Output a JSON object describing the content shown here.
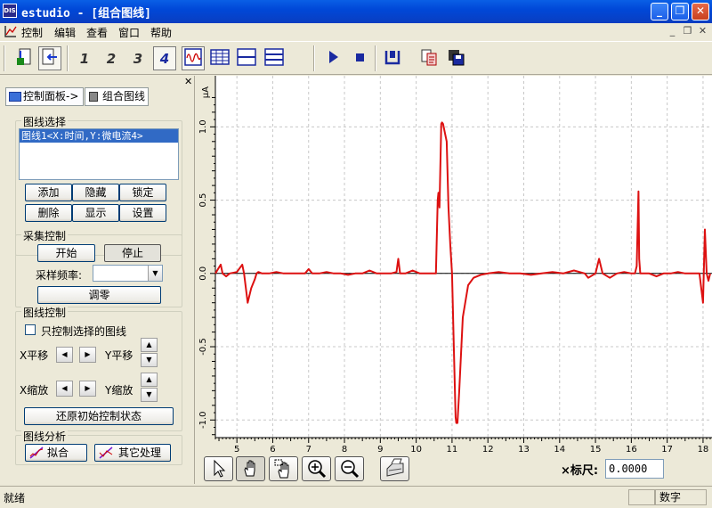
{
  "window": {
    "title": "estudio - [组合图线]",
    "app_icon_text": "DIS"
  },
  "menu": {
    "items": [
      "控制",
      "编辑",
      "查看",
      "窗口",
      "帮助"
    ]
  },
  "toolbar": {
    "number_buttons": [
      "1",
      "2",
      "3",
      "4"
    ]
  },
  "left_panel": {
    "tabs": [
      "控制面板->",
      "组合图线"
    ],
    "curve_select": {
      "title": "图线选择",
      "list_items": [
        "图线1<X:时间,Y:微电流4>"
      ],
      "buttons": [
        "添加",
        "隐藏",
        "锁定",
        "删除",
        "显示",
        "设置"
      ]
    },
    "acquisition": {
      "title": "采集控制",
      "start_label": "开始",
      "stop_label": "停止",
      "rate_label": "采样频率:",
      "rate_value": "",
      "zero_label": "调零"
    },
    "curve_control": {
      "title": "图线控制",
      "checkbox_label": "只控制选择的图线",
      "checkbox_checked": false,
      "x_move_label": "X平移",
      "y_move_label": "Y平移",
      "x_zoom_label": "X缩放",
      "y_zoom_label": "Y缩放",
      "reset_label": "还原初始控制状态"
    },
    "analysis": {
      "title": "图线分析",
      "fit_label": "拟合",
      "other_label": "其它处理"
    }
  },
  "bottom_bar": {
    "scale_label": "×标尺:",
    "scale_value": "0.0000"
  },
  "status_bar": {
    "text": "就绪",
    "mode": "数字"
  },
  "colors": {
    "series": "#dd1111",
    "grid": "#c8c8c8",
    "selection": "#316ac5",
    "title_bar": "#0a3dc0"
  },
  "chart_data": {
    "type": "line",
    "ylabel": "μA",
    "xlim": [
      4.4,
      18.2
    ],
    "ylim": [
      -1.12,
      1.3
    ],
    "x_ticks": [
      5,
      6,
      7,
      8,
      9,
      10,
      11,
      12,
      13,
      14,
      15,
      16,
      17,
      18
    ],
    "x_tick_labels": [
      "5",
      "6",
      "7",
      "8",
      "9",
      "10",
      "11",
      "12",
      "13",
      "14",
      "15",
      "16",
      "17",
      "18"
    ],
    "y_ticks": [
      -1.0,
      -0.5,
      0.0,
      0.5,
      1.0
    ],
    "y_tick_labels": [
      "-1.0",
      "-0.5",
      "0.0",
      "0.5",
      "1.0"
    ],
    "grid": true,
    "series": [
      {
        "color": "#dd1111",
        "x": [
          4.4,
          4.55,
          4.6,
          4.7,
          4.8,
          5.0,
          5.15,
          5.2,
          5.3,
          5.4,
          5.5,
          5.55,
          5.6,
          5.7,
          5.9,
          6.1,
          6.3,
          6.5,
          6.7,
          6.9,
          7.0,
          7.1,
          7.3,
          7.5,
          7.7,
          7.9,
          8.1,
          8.3,
          8.5,
          8.7,
          8.9,
          9.1,
          9.3,
          9.45,
          9.5,
          9.55,
          9.7,
          9.9,
          10.1,
          10.3,
          10.5,
          10.55,
          10.6,
          10.62,
          10.65,
          10.7,
          10.72,
          10.75,
          10.85,
          10.9,
          10.95,
          11.0,
          11.05,
          11.1,
          11.12,
          11.15,
          11.2,
          11.3,
          11.45,
          11.6,
          11.8,
          12.0,
          12.3,
          12.6,
          12.9,
          13.2,
          13.5,
          13.8,
          14.1,
          14.4,
          14.7,
          14.8,
          15.0,
          15.05,
          15.1,
          15.2,
          15.4,
          15.6,
          15.8,
          16.0,
          16.1,
          16.15,
          16.2,
          16.22,
          16.25,
          16.3,
          16.5,
          16.7,
          16.9,
          17.1,
          17.3,
          17.5,
          17.7,
          17.9,
          18.0,
          18.05,
          18.1,
          18.15,
          18.2
        ],
        "y": [
          0.0,
          0.06,
          0.0,
          -0.02,
          0.0,
          0.01,
          0.06,
          0.0,
          -0.2,
          -0.1,
          -0.04,
          0.0,
          0.01,
          0.0,
          0.0,
          0.01,
          0.0,
          0.0,
          0.0,
          0.0,
          0.03,
          0.0,
          0.0,
          0.01,
          0.0,
          0.0,
          -0.01,
          0.0,
          0.0,
          0.02,
          0.0,
          0.0,
          0.0,
          0.01,
          0.1,
          0.0,
          0.0,
          0.02,
          0.0,
          0.0,
          0.0,
          0.0,
          0.5,
          0.55,
          0.45,
          1.02,
          1.03,
          1.02,
          0.9,
          0.45,
          0.2,
          0.0,
          -0.5,
          -0.98,
          -1.02,
          -1.02,
          -0.8,
          -0.3,
          -0.08,
          -0.03,
          -0.01,
          0.0,
          0.01,
          0.0,
          0.0,
          -0.01,
          0.0,
          0.01,
          0.0,
          0.02,
          0.0,
          -0.03,
          0.0,
          0.05,
          0.1,
          0.0,
          -0.03,
          0.0,
          0.01,
          0.0,
          0.0,
          0.05,
          0.56,
          0.1,
          0.0,
          0.0,
          0.0,
          -0.02,
          0.0,
          0.0,
          0.01,
          0.0,
          0.0,
          0.0,
          -0.2,
          0.3,
          0.0,
          -0.05,
          0.0
        ]
      }
    ]
  }
}
